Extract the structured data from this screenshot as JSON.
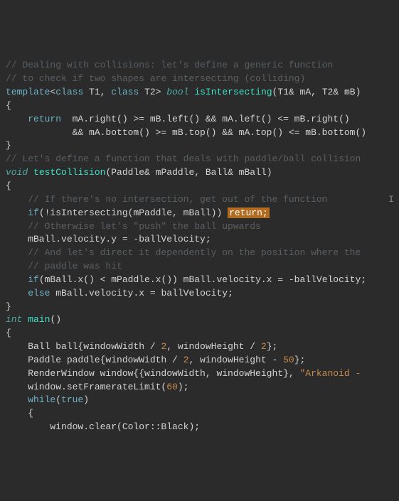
{
  "code": {
    "l1": "// Dealing with collisions: let's define a generic function",
    "l2": "// to check if two shapes are intersecting (colliding)",
    "l3a": "template",
    "l3b": "<",
    "l3c": "class",
    "l3d": " T1, ",
    "l3e": "class",
    "l3f": " T2> ",
    "l3g": "bool",
    "l3h": " ",
    "l3i": "isIntersecting",
    "l3j": "(T1& mA, T2& mB)",
    "l4": "{",
    "l5a": "    ",
    "l5b": "return",
    "l5c": "  mA.right() >= mB.left() && mA.left() <= mB.right()",
    "l6": "            && mA.bottom() >= mB.top() && mA.top() <= mB.bottom()",
    "l7": "}",
    "l8": "",
    "l9": "// Let's define a function that deals with paddle/ball collision",
    "l10a": "void",
    "l10b": " ",
    "l10c": "testCollision",
    "l10d": "(Paddle& mPaddle, Ball& mBall)",
    "l11": "{",
    "l12": "    // If there's no intersection, get out of the function",
    "l13a": "    ",
    "l13b": "if",
    "l13c": "(!isIntersecting(mPaddle, mBall)) ",
    "l13d": "return;",
    "l14": "",
    "l15": "    // Otherwise let's \"push\" the ball upwards",
    "l16": "    mBall.velocity.y = -ballVelocity;",
    "l17": "",
    "l18": "    // And let's direct it dependently on the position where the",
    "l19": "    // paddle was hit",
    "l20a": "    ",
    "l20b": "if",
    "l20c": "(mBall.x() < mPaddle.x()) mBall.velocity.x = -ballVelocity;",
    "l21a": "    ",
    "l21b": "else",
    "l21c": " mBall.velocity.x = ballVelocity;",
    "l22": "}",
    "l23": "",
    "l24a": "int",
    "l24b": " ",
    "l24c": "main",
    "l24d": "()",
    "l25": "{",
    "l26a": "    Ball ball{windowWidth / ",
    "l26b": "2",
    "l26c": ", windowHeight / ",
    "l26d": "2",
    "l26e": "};",
    "l27a": "    Paddle paddle{windowWidth / ",
    "l27b": "2",
    "l27c": ", windowHeight - ",
    "l27d": "50",
    "l27e": "};",
    "l28": "",
    "l29a": "    RenderWindow window{{windowWidth, windowHeight}, ",
    "l29b": "\"Arkanoid -",
    "l30a": "    window.setFramerateLimit(",
    "l30b": "60",
    "l30c": ");",
    "l31": "",
    "l32a": "    ",
    "l32b": "while",
    "l32c": "(",
    "l32d": "true",
    "l32e": ")",
    "l33": "    {",
    "l34": "        window.clear(Color::Black);"
  }
}
